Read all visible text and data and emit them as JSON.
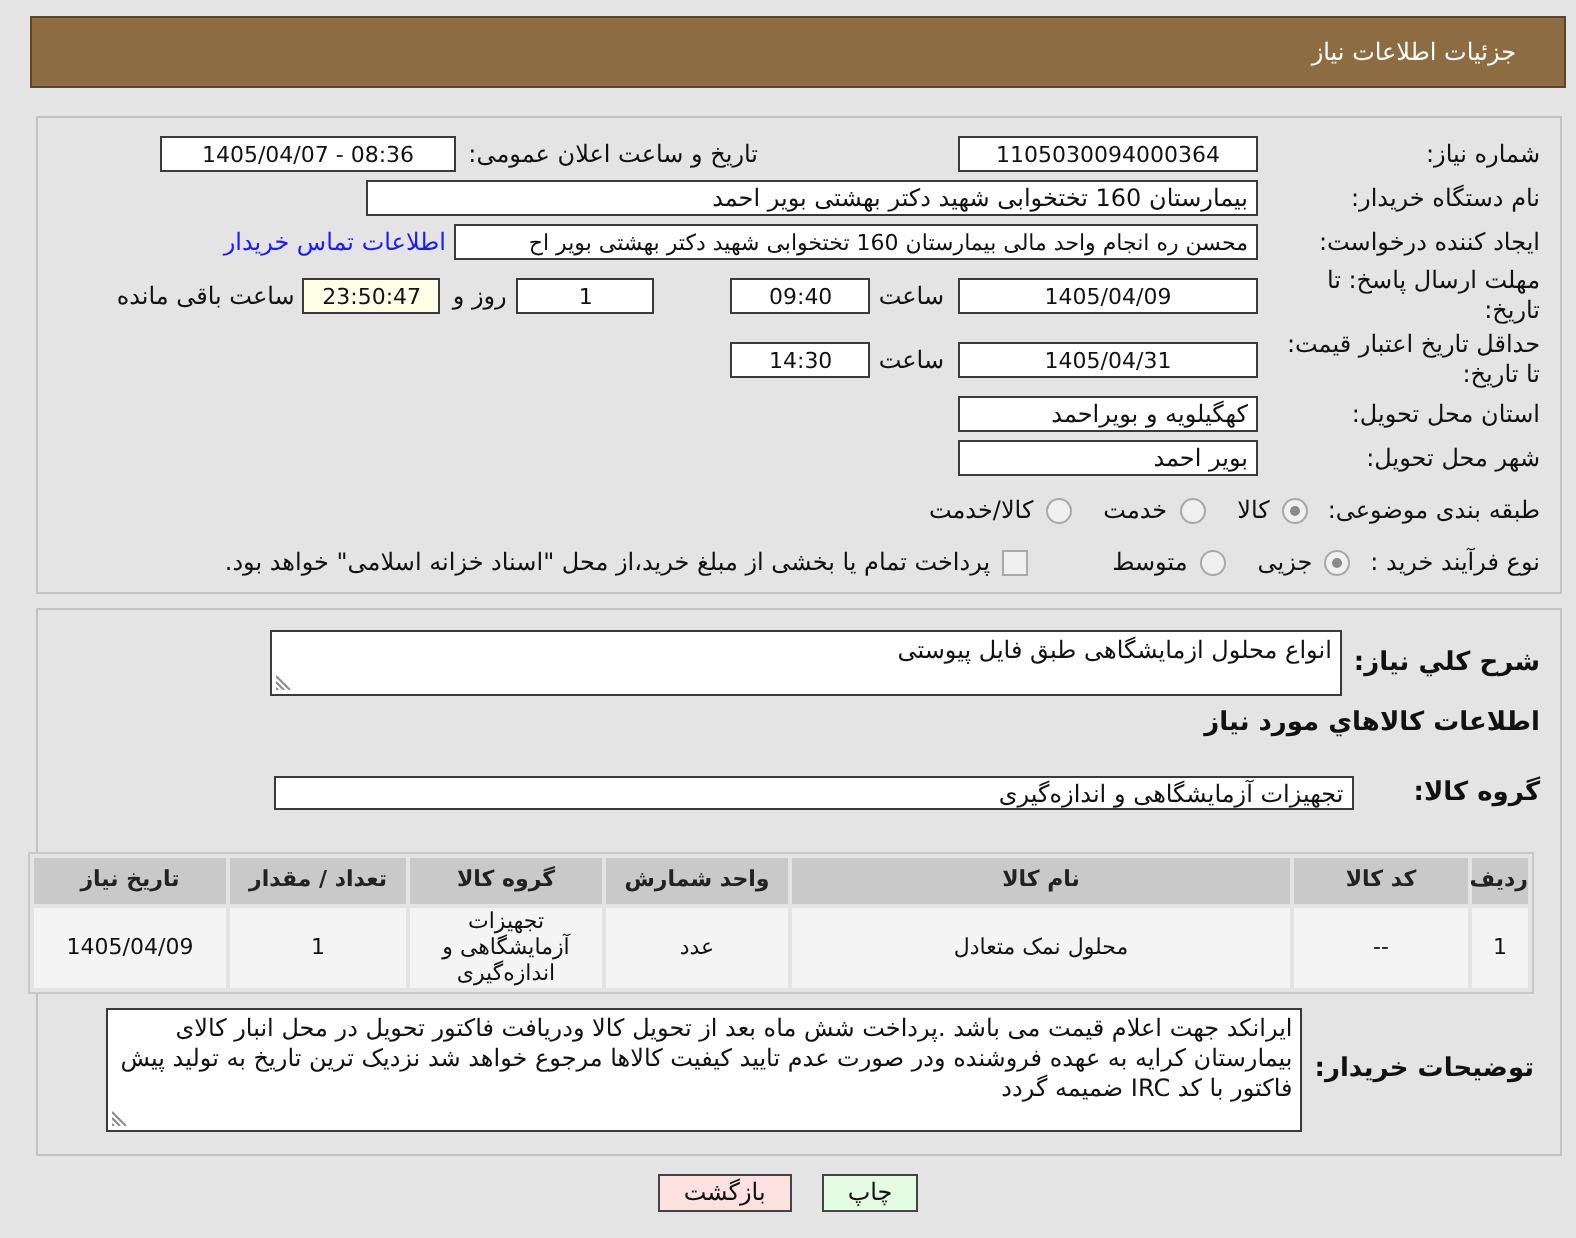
{
  "header": {
    "title": "جزئیات اطلاعات نیاز"
  },
  "need": {
    "number_label": "شماره نیاز:",
    "number": "1105030094000364",
    "announce_label": "تاریخ و ساعت اعلان عمومی:",
    "announce": "1405/04/07 - 08:36"
  },
  "buyer": {
    "label": "نام دستگاه خریدار:",
    "value": "بیمارستان 160 تختخوابی شهید دکتر بهشتی بویر احمد"
  },
  "creator": {
    "label": "ایجاد کننده درخواست:",
    "value": "محسن ره انجام واحد مالی بیمارستان 160 تختخوابی شهید دکتر بهشتی بویر اح",
    "link": "اطلاعات تماس خریدار"
  },
  "deadline": {
    "label": "مهلت ارسال پاسخ: تا تاریخ:",
    "date": "1405/04/09",
    "time_label": "ساعت",
    "time": "09:40",
    "days": "1",
    "days_label": "روز و",
    "remaining": "23:50:47",
    "remaining_label": "ساعت باقی مانده"
  },
  "price_validity": {
    "label": "حداقل تاریخ اعتبار قیمت: تا تاریخ:",
    "date": "1405/04/31",
    "time_label": "ساعت",
    "time": "14:30"
  },
  "province": {
    "label": "استان محل تحویل:",
    "value": "کهگیلویه و بویراحمد"
  },
  "city": {
    "label": "شهر محل تحویل:",
    "value": "بویر احمد"
  },
  "category": {
    "label": "طبقه بندی موضوعی:",
    "options": [
      {
        "label": "کالا",
        "selected": true
      },
      {
        "label": "خدمت",
        "selected": false
      },
      {
        "label": "کالا/خدمت",
        "selected": false
      }
    ]
  },
  "purchase_type": {
    "label": "نوع فرآیند خرید :",
    "options": [
      {
        "label": "جزیی",
        "selected": true
      },
      {
        "label": "متوسط",
        "selected": false
      }
    ],
    "treasury": {
      "label": "پرداخت تمام یا بخشی از مبلغ خرید،از محل \"اسناد خزانه اسلامی\" خواهد بود.",
      "checked": false
    }
  },
  "description": {
    "label": "شرح کلي نياز:",
    "value": "انواع محلول ازمایشگاهی طبق فایل پیوستی"
  },
  "goods": {
    "title": "اطلاعات کالاهاي مورد نياز",
    "group_label": "گروه کالا:",
    "group": "تجهیزات آزمایشگاهی و اندازه‌گیری",
    "table": {
      "columns": [
        "ردیف",
        "کد کالا",
        "نام کالا",
        "واحد شمارش",
        "گروه کالا",
        "تعداد / مقدار",
        "تاریخ نیاز"
      ],
      "rows": [
        [
          "1",
          "--",
          "محلول نمک متعادل",
          "عدد",
          "تجهیزات آزمایشگاهی و اندازه‌گیری",
          "1",
          "1405/04/09"
        ]
      ]
    }
  },
  "buyer_notes": {
    "label": "توضیحات خریدار:",
    "value": "ایرانکد جهت اعلام قیمت می باشد .پرداخت شش ماه بعد از تحویل کالا ودریافت فاکتور تحویل در محل انبار کالای بیمارستان کرایه به عهده فروشنده ودر صورت عدم تایید کیفیت کالاها مرجوع خواهد شد نزدیک ترین تاریخ به تولید پیش فاکتور با کد IRC ضمیمه گردد"
  },
  "buttons": [
    {
      "label": "چاپ",
      "kind": "print"
    },
    {
      "label": "بازگشت",
      "kind": "back"
    }
  ]
}
